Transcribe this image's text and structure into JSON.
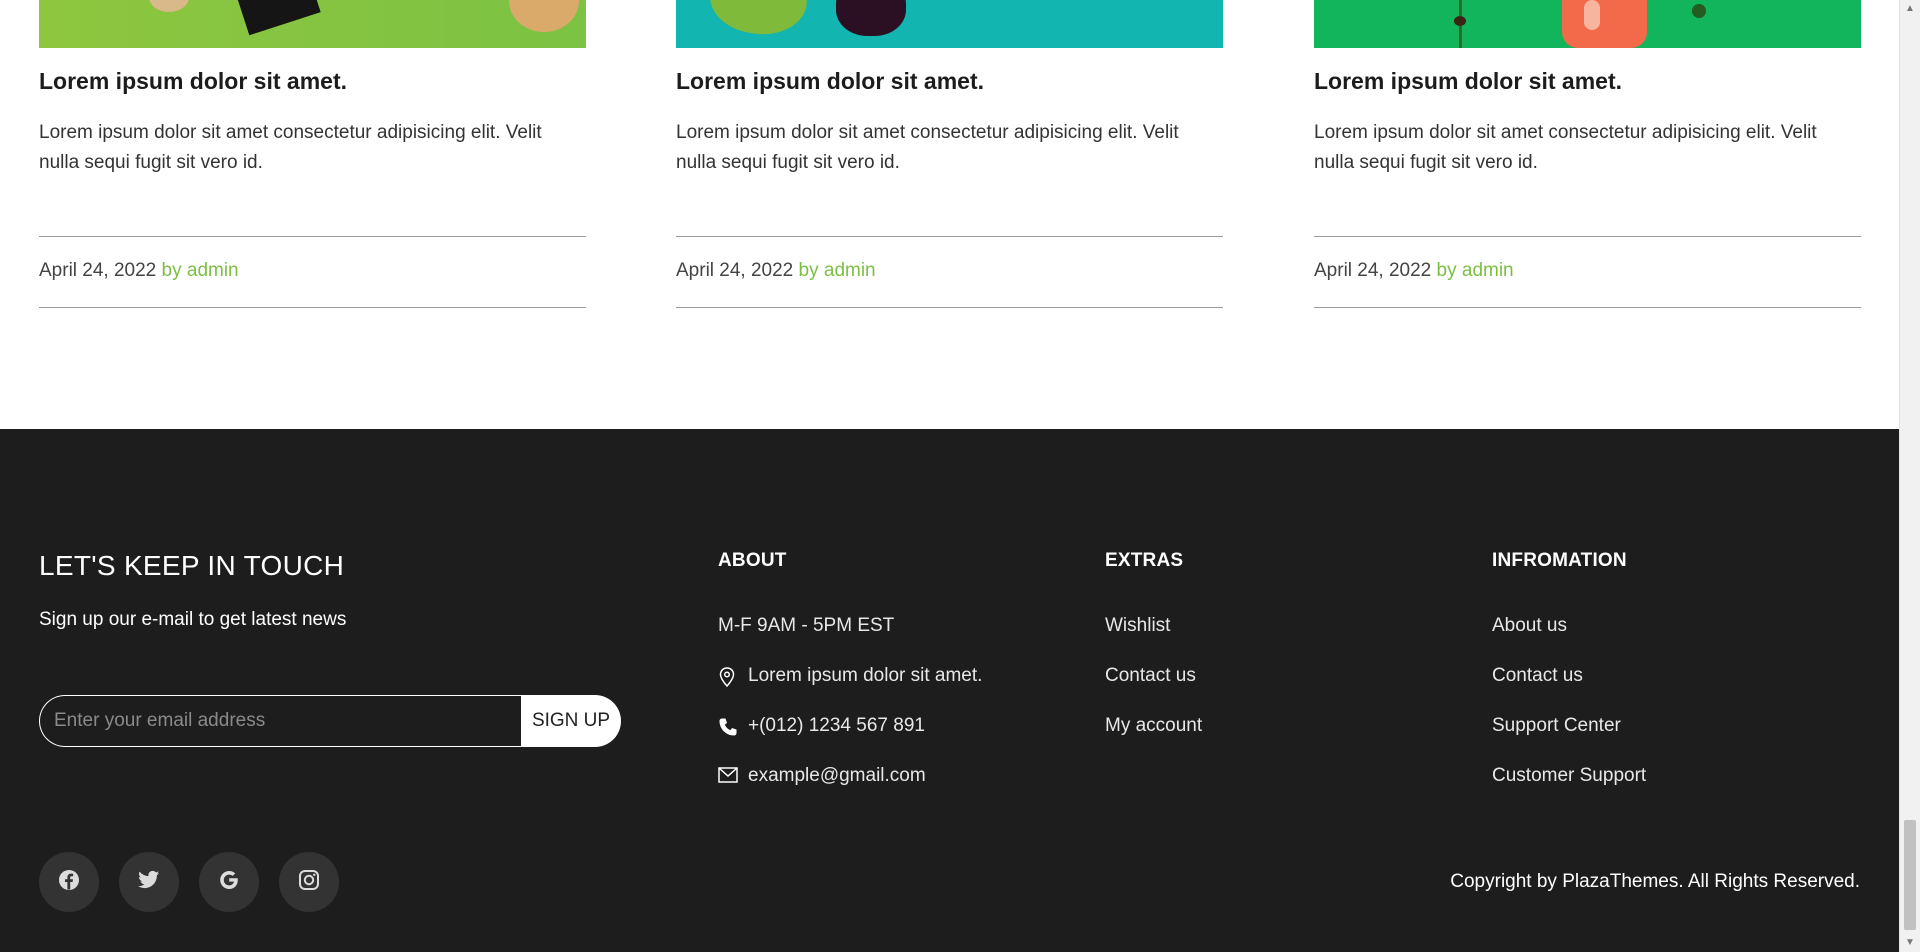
{
  "colors": {
    "accent": "#7cbf45",
    "footer_bg": "#1d1d1d",
    "social_bg": "#333333"
  },
  "cards": [
    {
      "title": "Lorem ipsum dolor sit amet.",
      "text": "Lorem ipsum dolor sit amet consectetur adipisicing elit. Velit nulla sequi fugit sit vero id.",
      "date": "April 24, 2022",
      "author": "by admin"
    },
    {
      "title": "Lorem ipsum dolor sit amet.",
      "text": "Lorem ipsum dolor sit amet consectetur adipisicing elit. Velit nulla sequi fugit sit vero id.",
      "date": "April 24, 2022",
      "author": "by admin"
    },
    {
      "title": "Lorem ipsum dolor sit amet.",
      "text": "Lorem ipsum dolor sit amet consectetur adipisicing elit. Velit nulla sequi fugit sit vero id.",
      "date": "April 24, 2022",
      "author": "by admin"
    }
  ],
  "footer": {
    "touch_title": "LET'S KEEP IN TOUCH",
    "touch_sub": "Sign up our e-mail to get latest news",
    "email_placeholder": "Enter your email address",
    "signup_label": "SIGN UP",
    "about": {
      "title": "ABOUT",
      "hours": "M-F 9AM - 5PM EST",
      "address": "Lorem ipsum dolor sit amet.",
      "phone": "+(012) 1234 567 891",
      "email": "example@gmail.com"
    },
    "extras": {
      "title": "EXTRAS",
      "items": [
        "Wishlist",
        "Contact us",
        "My account"
      ]
    },
    "information": {
      "title": "INFROMATION",
      "items": [
        "About us",
        "Contact us",
        "Support Center",
        "Customer Support"
      ]
    },
    "socials": [
      "facebook-icon",
      "twitter-icon",
      "google-icon",
      "instagram-icon"
    ],
    "copyright": "Copyright by PlazaThemes. All Rights Reserved."
  }
}
